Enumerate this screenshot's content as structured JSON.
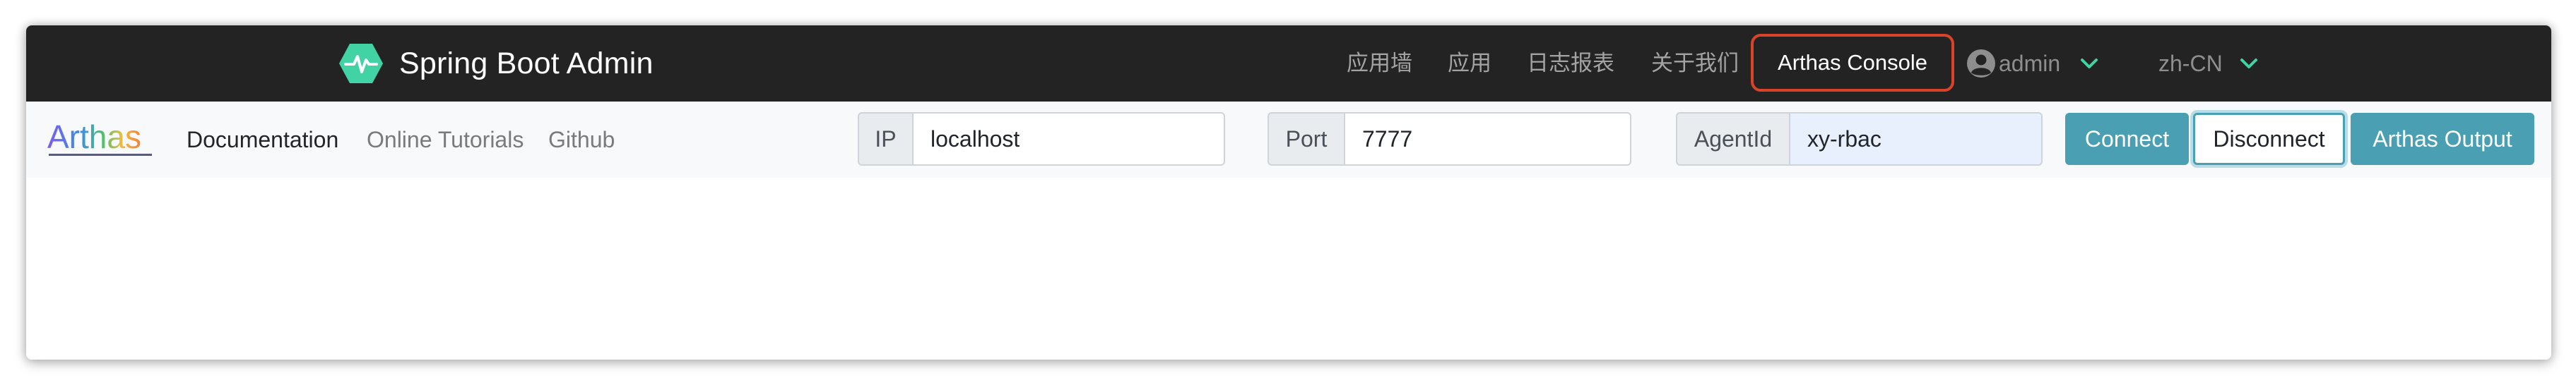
{
  "topnav": {
    "brand_title": "Spring Boot Admin",
    "items": [
      {
        "label": "应用墙"
      },
      {
        "label": "应用"
      },
      {
        "label": "日志报表"
      },
      {
        "label": "关于我们"
      }
    ],
    "console_label": "Arthas Console",
    "user": {
      "name": "admin",
      "icon": "user-circle-icon"
    },
    "language": {
      "value": "zh-CN"
    },
    "colors": {
      "background": "#232323",
      "accent": "#42d3a5",
      "highlight_border": "#d9432a",
      "inactive_text": "#a3a3a3"
    }
  },
  "arthas": {
    "logo_text": "Arthas",
    "links": [
      {
        "label": "Documentation"
      },
      {
        "label": "Online Tutorials"
      },
      {
        "label": "Github"
      }
    ],
    "ip": {
      "label": "IP",
      "value": "localhost"
    },
    "port": {
      "label": "Port",
      "value": "7777"
    },
    "agent": {
      "label": "AgentId",
      "value": "xy-rbac"
    },
    "buttons": {
      "connect": "Connect",
      "disconnect": "Disconnect",
      "output": "Arthas Output"
    },
    "colors": {
      "button": "#4a9fb2",
      "autofill": "#e8f0fe"
    }
  }
}
